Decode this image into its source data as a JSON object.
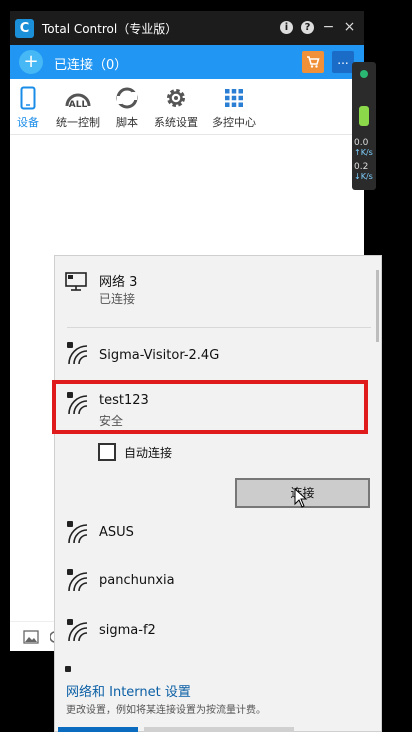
{
  "app": {
    "title": "Total Control（专业版）",
    "logo_letter": "C",
    "title_buttons": [
      "i",
      "?",
      "−",
      "×"
    ]
  },
  "connection_bar": {
    "status": "已连接（0）",
    "add_icon": "+",
    "more_icon": "..."
  },
  "toolbar": {
    "items": [
      {
        "label": "设备",
        "icon": "phone-icon",
        "active": true
      },
      {
        "label": "统一控制",
        "icon": "all-icon",
        "active": false
      },
      {
        "label": "脚本",
        "icon": "script-icon",
        "active": false
      },
      {
        "label": "系统设置",
        "icon": "gear-icon",
        "active": false
      },
      {
        "label": "多控中心",
        "icon": "grid-icon",
        "active": false
      }
    ],
    "all_text": "ALL"
  },
  "side_monitor": {
    "up_speed": "0.0",
    "up_unit": "K/s",
    "down_speed": "0.2",
    "down_unit": "K/s"
  },
  "network": {
    "ethernet": {
      "name": "网络 3",
      "status": "已连接"
    },
    "wifi": [
      {
        "name": "Sigma-Visitor-2.4G"
      },
      {
        "name": "test123",
        "status": "安全"
      },
      {
        "name": "ASUS"
      },
      {
        "name": "panchunxia"
      },
      {
        "name": "sigma-f2"
      }
    ],
    "auto_connect_label": "自动连接",
    "connect_button": "连接",
    "settings_link": "网络和 Internet 设置",
    "settings_desc": "更改设置，例如将某连接设置为按流量计费。"
  },
  "colors": {
    "accent": "#2196f3",
    "highlight": "#e01b1b",
    "link": "#0b5fa5"
  }
}
